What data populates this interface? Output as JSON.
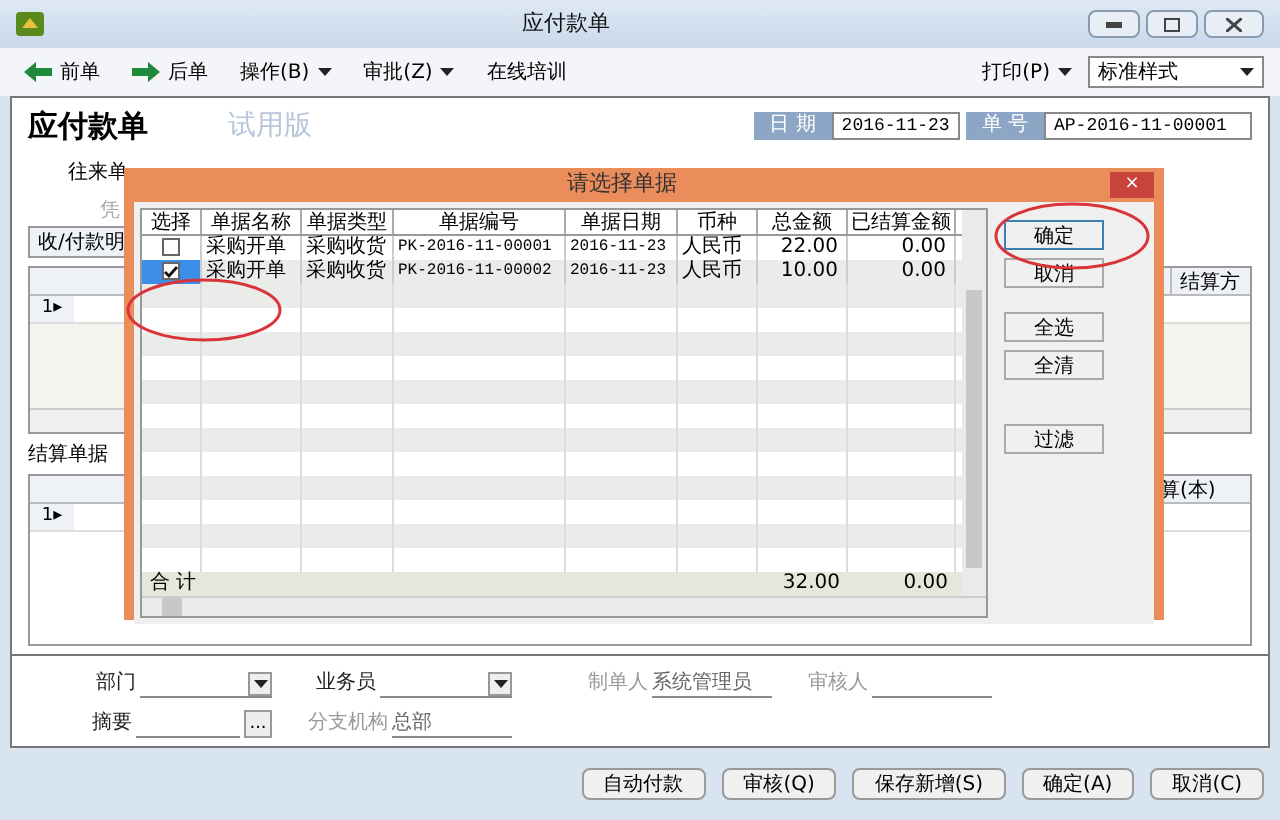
{
  "window": {
    "title": "应付款单"
  },
  "toolbar": {
    "items": [
      {
        "label": "前单",
        "kind": "prev"
      },
      {
        "label": "后单",
        "kind": "next"
      },
      {
        "label": "操作(B)",
        "kind": "menu"
      },
      {
        "label": "审批(Z)",
        "kind": "menu"
      },
      {
        "label": "在线培训",
        "kind": "plain"
      }
    ],
    "print": "打印(P)",
    "style_select": "标准样式"
  },
  "header": {
    "title": "应付款单",
    "watermark": "试用版",
    "date_label": "日 期",
    "date": "2016-11-23",
    "number_label": "单 号",
    "number": "AP-2016-11-00001"
  },
  "form_labels": [
    "往来单",
    "凭"
  ],
  "detail_tab": "收/付款明",
  "grid1": {
    "row_marker": "1",
    "pointer": "▸",
    "column": "结算方"
  },
  "settle_label": "结算单据",
  "grid2": {
    "row_marker": "1",
    "pointer": "▸",
    "column": "算(本)"
  },
  "fields": [
    {
      "label": "部门",
      "kind": "select",
      "disabled": false
    },
    {
      "label": "业务员",
      "kind": "select",
      "disabled": false
    },
    {
      "label": "制单人",
      "kind": "text",
      "disabled": true,
      "value": "系统管理员"
    },
    {
      "label": "审核人",
      "kind": "text",
      "disabled": true
    },
    {
      "label": "摘要",
      "kind": "browse",
      "disabled": false,
      "button": "..."
    },
    {
      "label": "分支机构",
      "kind": "text",
      "disabled": true,
      "value": "总部"
    }
  ],
  "footer_buttons": [
    "自动付款",
    "审核(Q)",
    "保存新增(S)",
    "确定(A)",
    "取消(C)"
  ],
  "dialog": {
    "title": "请选择单据",
    "close": "×",
    "select_column": "选择",
    "columns": [
      "单据名称",
      "单据类型",
      "单据编号",
      "单据日期",
      "币种",
      "总金额",
      "已结算金额"
    ],
    "rows": [
      {
        "checked": false,
        "selected": false,
        "cells": [
          "采购开单",
          "采购收货",
          "PK-2016-11-00001",
          "2016-11-23",
          "人民币",
          "22.00",
          "0.00"
        ]
      },
      {
        "checked": true,
        "selected": true,
        "cells": [
          "采购开单",
          "采购收货",
          "PK-2016-11-00002",
          "2016-11-23",
          "人民币",
          "10.00",
          "0.00"
        ]
      }
    ],
    "total": {
      "label": "合 计",
      "amount": "32.00",
      "settled": "0.00"
    },
    "buttons": [
      "确定",
      "取消",
      "全选",
      "全清",
      "过滤"
    ]
  }
}
